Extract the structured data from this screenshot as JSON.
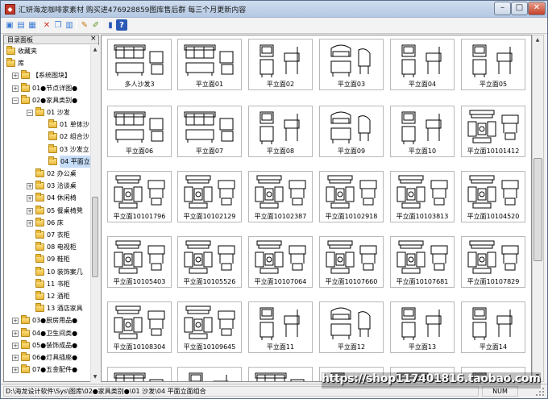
{
  "window": {
    "title": "汇妍海龙咖啡家素材 购买进476928859图库售后群 每三个月更新内容",
    "min_symbol": "–",
    "max_symbol": "□",
    "close_symbol": "✕"
  },
  "toolbar": {
    "buttons": [
      {
        "name": "open-folder-icon",
        "glyph": "▣",
        "color": "#3a7bd5"
      },
      {
        "name": "view-icon",
        "glyph": "▤",
        "color": "#3a7bd5"
      },
      {
        "name": "list-icon",
        "glyph": "▦",
        "color": "#3a7bd5"
      },
      {
        "name": "delete-icon",
        "glyph": "✕",
        "color": "#d03020"
      },
      {
        "name": "copy-icon",
        "glyph": "❐",
        "color": "#3a7bd5"
      },
      {
        "name": "paste-icon",
        "glyph": "▥",
        "color": "#3a7bd5"
      },
      {
        "name": "pencil-icon",
        "glyph": "✎",
        "color": "#c07a10"
      },
      {
        "name": "brush-icon",
        "glyph": "✐",
        "color": "#5a9a20"
      },
      {
        "name": "book-icon",
        "glyph": "▮",
        "color": "#2a5ab5"
      },
      {
        "name": "help-icon",
        "glyph": "?",
        "color": "#ffffff"
      }
    ]
  },
  "panel": {
    "title": "目录面板",
    "close": "×"
  },
  "tree": [
    {
      "label": "收藏夹",
      "level": 0,
      "exp": "",
      "icon": "star"
    },
    {
      "label": "库",
      "level": 0,
      "exp": "",
      "icon": "folder"
    },
    {
      "label": "【系统图块】",
      "level": 1,
      "exp": "+"
    },
    {
      "label": "01●节点详图●",
      "level": 1,
      "exp": "+"
    },
    {
      "label": "02●家具类别●",
      "level": 1,
      "exp": "-"
    },
    {
      "label": "01 沙发",
      "level": 2,
      "exp": "-"
    },
    {
      "label": "01 单体沙",
      "level": 3,
      "exp": ""
    },
    {
      "label": "02 组合沙",
      "level": 3,
      "exp": ""
    },
    {
      "label": "03 沙发立",
      "level": 3,
      "exp": ""
    },
    {
      "label": "04 平面立",
      "level": 3,
      "exp": "",
      "selected": true
    },
    {
      "label": "02 办公桌",
      "level": 2,
      "exp": ""
    },
    {
      "label": "03 洽谈桌",
      "level": 2,
      "exp": "+"
    },
    {
      "label": "04 休闲椅",
      "level": 2,
      "exp": "+"
    },
    {
      "label": "05 餐桌椅凳",
      "level": 2,
      "exp": "+"
    },
    {
      "label": "06 床",
      "level": 2,
      "exp": "+"
    },
    {
      "label": "07 衣柜",
      "level": 2,
      "exp": ""
    },
    {
      "label": "08 电视柜",
      "level": 2,
      "exp": ""
    },
    {
      "label": "09 鞋柜",
      "level": 2,
      "exp": ""
    },
    {
      "label": "10 装饰案几",
      "level": 2,
      "exp": ""
    },
    {
      "label": "11 书柜",
      "level": 2,
      "exp": ""
    },
    {
      "label": "12 酒柜",
      "level": 2,
      "exp": ""
    },
    {
      "label": "13 酒店家具",
      "level": 2,
      "exp": ""
    },
    {
      "label": "03●厨房用品●",
      "level": 1,
      "exp": "+"
    },
    {
      "label": "04●卫生间类●",
      "level": 1,
      "exp": "+"
    },
    {
      "label": "05●装饰成品●",
      "level": 1,
      "exp": "+"
    },
    {
      "label": "06●灯具插座●",
      "level": 1,
      "exp": "+"
    },
    {
      "label": "07●五金配件●",
      "level": 1,
      "exp": "+"
    }
  ],
  "tree_scroll": {
    "up": "▲",
    "down": "▼"
  },
  "thumbnails": [
    {
      "caption": "多人沙发3",
      "kind": "sofa"
    },
    {
      "caption": "平立面01",
      "kind": "sofa"
    },
    {
      "caption": "平立面02",
      "kind": "chair"
    },
    {
      "caption": "平立面03",
      "kind": "armchair"
    },
    {
      "caption": "平立面04",
      "kind": "chair"
    },
    {
      "caption": "平立面05",
      "kind": "chair"
    },
    {
      "caption": "平立面06",
      "kind": "sofa"
    },
    {
      "caption": "平立面07",
      "kind": "sofa"
    },
    {
      "caption": "平立面08",
      "kind": "chair"
    },
    {
      "caption": "平立面09",
      "kind": "armchair"
    },
    {
      "caption": "平立面10",
      "kind": "chair"
    },
    {
      "caption": "平立面10101412",
      "kind": "set"
    },
    {
      "caption": "平立面10101796",
      "kind": "set"
    },
    {
      "caption": "平立面10102129",
      "kind": "set"
    },
    {
      "caption": "平立面10102387",
      "kind": "set"
    },
    {
      "caption": "平立面10102918",
      "kind": "set"
    },
    {
      "caption": "平立面10103813",
      "kind": "set"
    },
    {
      "caption": "平立面10104520",
      "kind": "set"
    },
    {
      "caption": "平立面10105403",
      "kind": "set"
    },
    {
      "caption": "平立面10105526",
      "kind": "set"
    },
    {
      "caption": "平立面10107064",
      "kind": "set"
    },
    {
      "caption": "平立面10107660",
      "kind": "set"
    },
    {
      "caption": "平立面10107681",
      "kind": "set"
    },
    {
      "caption": "平立面10107829",
      "kind": "set"
    },
    {
      "caption": "平立面10108304",
      "kind": "set"
    },
    {
      "caption": "平立面10109645",
      "kind": "set"
    },
    {
      "caption": "平立面11",
      "kind": "chair"
    },
    {
      "caption": "平立面12",
      "kind": "armchair"
    },
    {
      "caption": "平立面13",
      "kind": "chair"
    },
    {
      "caption": "平立面14",
      "kind": "chair"
    },
    {
      "caption": "",
      "kind": "sofa"
    },
    {
      "caption": "",
      "kind": "chair"
    },
    {
      "caption": "",
      "kind": "sofa"
    },
    {
      "caption": "",
      "kind": "chair"
    },
    {
      "caption": "",
      "kind": "sofa"
    },
    {
      "caption": "",
      "kind": "chair"
    }
  ],
  "main_scroll": {
    "up": "▲",
    "down": "▼"
  },
  "status": {
    "path": "D:\\海龙设计软件\\Sys\\图库\\02●家具类别●\\01 沙发\\04 平面立面组合",
    "num": "NUM"
  },
  "watermark": "https://shop117401816.taobao.com"
}
